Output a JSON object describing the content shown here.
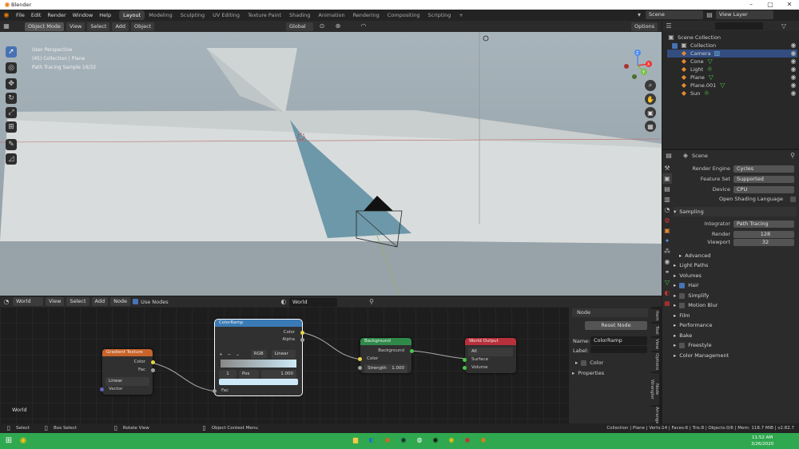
{
  "window": {
    "title": "Blender",
    "min": "–",
    "max": "▢",
    "close": "✕"
  },
  "menubar": {
    "items": [
      "File",
      "Edit",
      "Render",
      "Window",
      "Help"
    ],
    "workspaces": [
      "Layout",
      "Modeling",
      "Sculpting",
      "UV Editing",
      "Texture Paint",
      "Shading",
      "Animation",
      "Rendering",
      "Compositing",
      "Scripting"
    ],
    "add_tab": "+",
    "scene": "Scene",
    "view_layer": "View Layer"
  },
  "viewport": {
    "mode": "Object Mode",
    "menus": [
      "View",
      "Select",
      "Add",
      "Object"
    ],
    "orientation": "Global",
    "options": "Options",
    "overlay_text": [
      "User Perspective",
      "(45) Collection | Plane",
      "Path Tracing Sample 16/32"
    ],
    "axis_x": "X",
    "axis_y": "Y",
    "axis_z": "Z"
  },
  "node_editor": {
    "editor": "World",
    "menus": [
      "View",
      "Select",
      "Add",
      "Node"
    ],
    "use_nodes": "Use Nodes",
    "world_name": "World",
    "frame_label": "World",
    "gradient": {
      "title": "Gradient Texture",
      "out_color": "Color",
      "out_fac": "Fac",
      "type": "Linear",
      "in_vector": "Vector"
    },
    "colorramp": {
      "title": "ColorRamp",
      "out_color": "Color",
      "out_alpha": "Alpha",
      "plus": "+",
      "minus": "−",
      "chev": "⌄",
      "mode": "RGB",
      "interp": "Linear",
      "index": "1",
      "pos_label": "Pos",
      "pos_value": "1.000",
      "in_fac": "Fac"
    },
    "background": {
      "title": "Background",
      "out": "Background",
      "in_color": "Color",
      "strength_label": "Strength",
      "strength_value": "1.000"
    },
    "output": {
      "title": "World Output",
      "target": "All",
      "in_surface": "Surface",
      "in_volume": "Volume"
    }
  },
  "node_panel": {
    "header": "Node",
    "reset": "Reset Node",
    "name_label": "Name:",
    "name_value": "ColorRamp",
    "label_label": "Label:",
    "color": "Color",
    "properties": "Properties",
    "tabs": [
      "Item",
      "Tool",
      "View",
      "Options",
      "Node Wrangler",
      "Arrange"
    ]
  },
  "outliner": {
    "rows": [
      {
        "label": "Scene Collection",
        "color": "#d0d0d0"
      },
      {
        "label": "Collection",
        "color": "#d0d0d0"
      },
      {
        "label": "Camera",
        "color": "#d0d0d0",
        "icon": "#6fb6d8"
      },
      {
        "label": "Cone",
        "color": "#d0d0d0",
        "icon": "#e48b2f"
      },
      {
        "label": "Light",
        "color": "#d0d0d0",
        "icon": "#e48b2f"
      },
      {
        "label": "Plane",
        "color": "#d0d0d0",
        "icon": "#e48b2f"
      },
      {
        "label": "Plane.001",
        "color": "#d0d0d0",
        "icon": "#e48b2f"
      },
      {
        "label": "Sun",
        "color": "#d0d0d0",
        "icon": "#e48b2f"
      }
    ]
  },
  "properties": {
    "scene": "Scene",
    "render_engine_label": "Render Engine",
    "render_engine": "Cycles",
    "feature_set_label": "Feature Set",
    "feature_set": "Supported",
    "device_label": "Device",
    "device": "CPU",
    "osl": "Open Shading Language",
    "sampling": "Sampling",
    "integrator_label": "Integrator",
    "integrator": "Path Tracing",
    "render_label": "Render",
    "render_val": "128",
    "viewport_label": "Viewport",
    "viewport_val": "32",
    "advanced": "Advanced",
    "light_paths": "Light Paths",
    "volumes": "Volumes",
    "hair": "Hair",
    "simplify": "Simplify",
    "motion_blur": "Motion Blur",
    "film": "Film",
    "performance": "Performance",
    "bake": "Bake",
    "freestyle": "Freestyle",
    "color_management": "Color Management"
  },
  "statusbar": {
    "select": "Select",
    "box_select": "Box Select",
    "rotate": "Rotate View",
    "context": "Object Context Menu",
    "info": "Collection | Plane | Verts:14 | Faces:6 | Tris:8 | Objects:0/6 | Mem: 118.7 MiB | v2.82.7"
  },
  "taskbar": {
    "time": "11:52 AM",
    "date": "3/26/2020"
  },
  "colors": {
    "accent": "#4772b3",
    "taskbar": "#2fa84f",
    "node_gradient": "#c8642a",
    "node_colorramp": "#3a7bb5",
    "node_background": "#2f8a4a",
    "node_output": "#b8303a"
  }
}
